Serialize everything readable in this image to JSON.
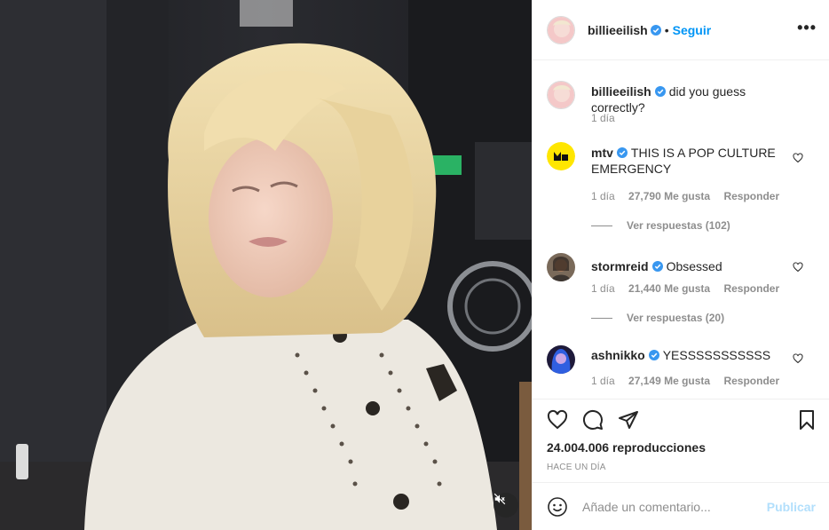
{
  "post": {
    "author": "billieeilish",
    "follow_label": "Seguir",
    "dot": "•",
    "more_label": "•••",
    "mute_icon": "muted-speaker-icon"
  },
  "caption": {
    "user": "billieeilish",
    "text": "did you guess correctly?",
    "time": "1 día"
  },
  "comments": [
    {
      "user": "mtv",
      "text": "THIS IS A POP CULTURE EMERGENCY",
      "time": "1 día",
      "likes": "27,790 Me gusta",
      "reply_label": "Responder",
      "view_replies": "Ver respuestas (102)"
    },
    {
      "user": "stormreid",
      "text": "Obsessed",
      "time": "1 día",
      "likes": "21,440 Me gusta",
      "reply_label": "Responder",
      "view_replies": "Ver respuestas (20)"
    },
    {
      "user": "ashnikko",
      "text": "YESSSSSSSSSSS",
      "time": "1 día",
      "likes": "27,149 Me gusta",
      "reply_label": "Responder"
    }
  ],
  "stats": {
    "views": "24.004.006 reproducciones",
    "posted_ago": "HACE UN DÍA"
  },
  "composer": {
    "placeholder": "Añade un comentario...",
    "publish_label": "Publicar"
  },
  "colors": {
    "link_blue": "#0095f6",
    "publish_disabled": "#b2dffc",
    "verified_blue": "#3897f0",
    "muted_text": "#8e8e8e"
  }
}
